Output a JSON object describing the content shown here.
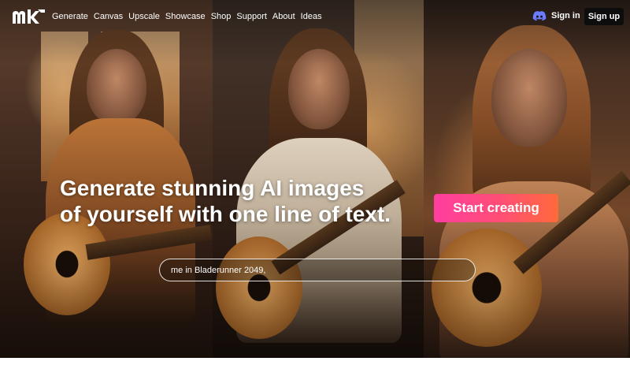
{
  "nav": {
    "logo_alt": "mk",
    "links": [
      "Generate",
      "Canvas",
      "Upscale",
      "Showcase",
      "Shop",
      "Support",
      "About",
      "Ideas"
    ],
    "signin_label": "Sign in",
    "signup_label": "Sign up",
    "discord_icon": "discord-icon"
  },
  "hero": {
    "headline_line1": "Generate stunning AI images",
    "headline_line2": "of yourself with one line of text.",
    "cta_label": "Start creating",
    "prompt_value": "me in Bladerunner 2049,",
    "colors": {
      "cta_start": "#ff3da0",
      "cta_end": "#ff6a3a",
      "signup_bg": "#0d0d0d"
    }
  }
}
